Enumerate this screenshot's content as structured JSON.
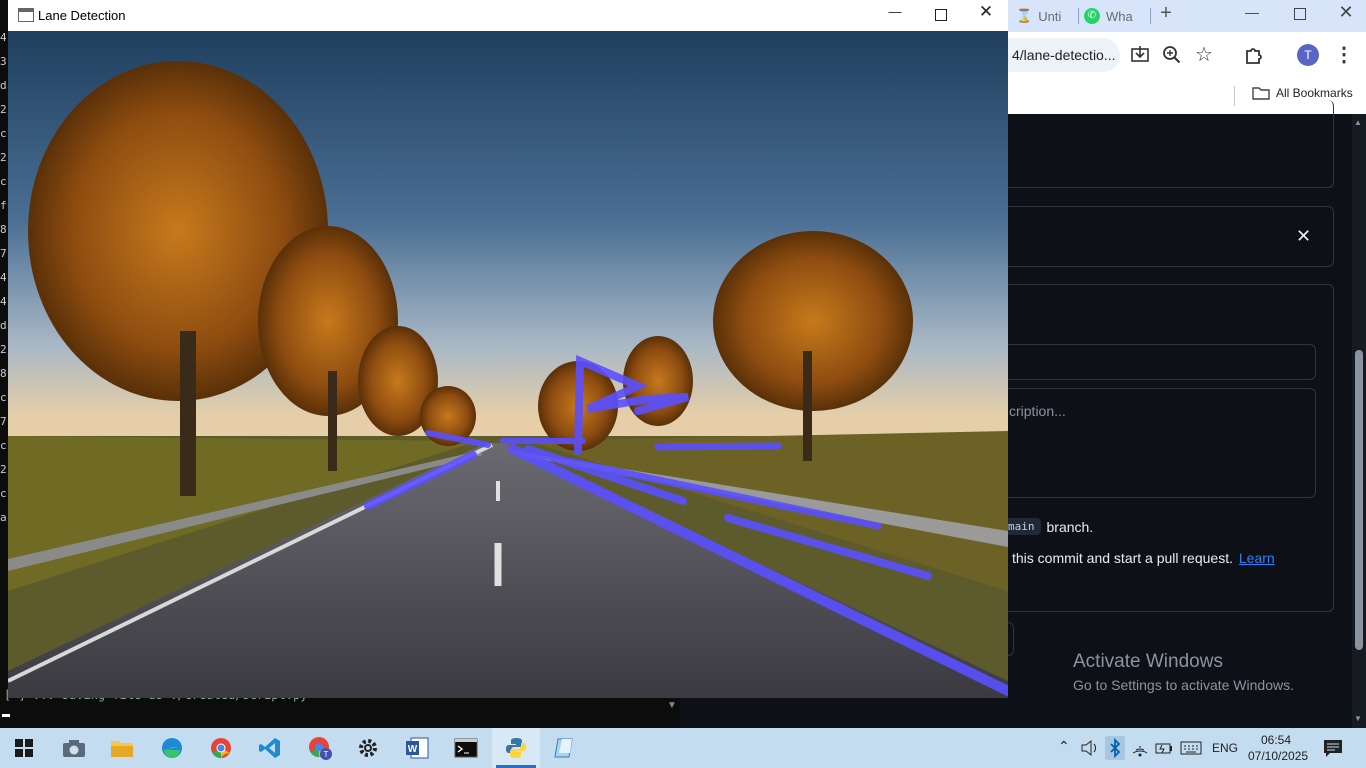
{
  "terminal": {
    "gutter": [
      "4",
      "3",
      "d",
      "2",
      "c",
      "2",
      "c",
      "f",
      "8",
      "7",
      "4",
      "4",
      "d",
      "2",
      "8",
      "c",
      "7",
      "c",
      "2",
      "c",
      "a"
    ],
    "last_line": "[  ] ... saving file as ./created/script.py",
    "prompt": "_"
  },
  "cv_window": {
    "title": "Lane Detection",
    "colors": {
      "lane_overlay": "#5a50ff",
      "title_bar": "#ffffff"
    }
  },
  "chrome": {
    "tabs": [
      {
        "label": "Unti",
        "icon": "hourglass-icon"
      },
      {
        "label": "Wha",
        "icon": "whatsapp-icon"
      }
    ],
    "new_tab": "+",
    "address_text": "4/lane-detectio...",
    "profile_initial": "T",
    "bookmarks_label": "All Bookmarks"
  },
  "github": {
    "description_placeholder": "cription...",
    "branch_code": "main",
    "branch_text": "branch.",
    "pr_text": "this commit and start a pull request.",
    "learn_link": "Learn",
    "activate_title": "Activate Windows",
    "activate_sub": "Go to Settings to activate Windows."
  },
  "taskbar": {
    "apps": [
      "start-icon",
      "camera-icon",
      "file-explorer-icon",
      "edge-icon",
      "chrome-icon",
      "vscode-icon",
      "chrome-profile-icon",
      "settings-icon",
      "word-icon",
      "terminal-icon",
      "python-icon",
      "notes-icon"
    ],
    "language": "ENG",
    "time": "06:54",
    "date": "07/10/2025"
  }
}
